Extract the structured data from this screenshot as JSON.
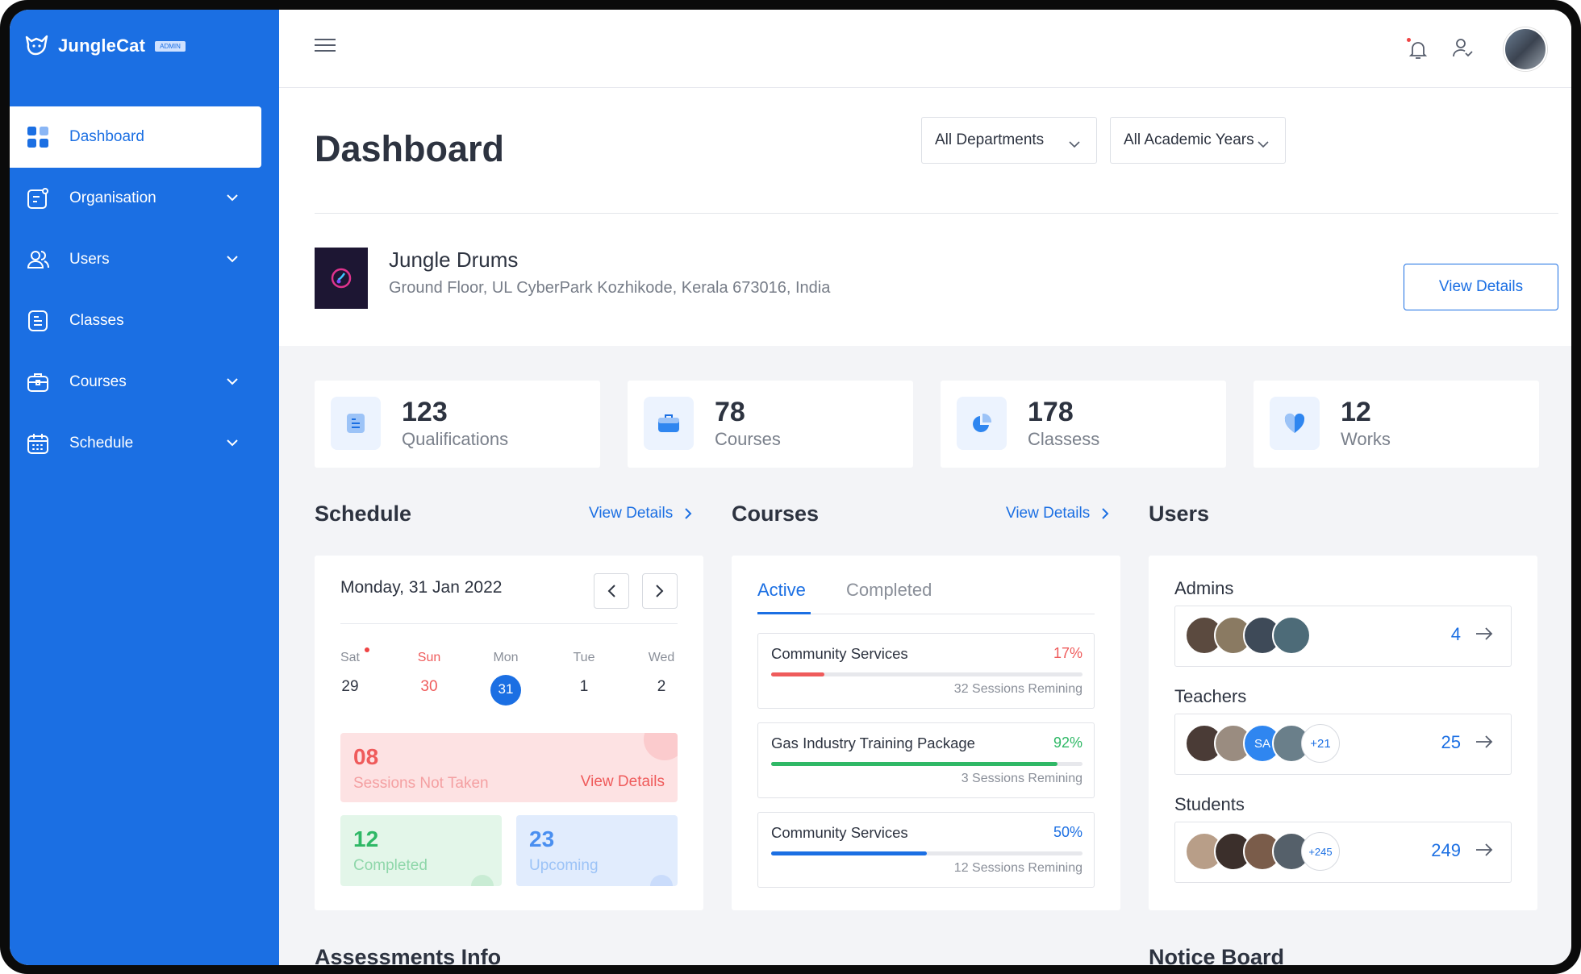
{
  "app": {
    "name": "JungleCat",
    "badge": "ADMIN"
  },
  "sidebar": {
    "items": [
      {
        "label": "Dashboard"
      },
      {
        "label": "Organisation"
      },
      {
        "label": "Users"
      },
      {
        "label": "Classes"
      },
      {
        "label": "Courses"
      },
      {
        "label": "Schedule"
      }
    ]
  },
  "header": {
    "title": "Dashboard",
    "department_select": "All Departments",
    "year_select": "All Academic Years"
  },
  "organisation": {
    "name": "Jungle Drums",
    "address": "Ground Floor, UL CyberPark Kozhikode, Kerala 673016, India",
    "view_details": "View Details"
  },
  "stats": [
    {
      "value": "123",
      "label": "Qualifications"
    },
    {
      "value": "78",
      "label": "Courses"
    },
    {
      "value": "178",
      "label": "Classess"
    },
    {
      "value": "12",
      "label": "Works"
    }
  ],
  "schedule": {
    "title": "Schedule",
    "view_details": "View Details",
    "date": "Monday, 31 Jan 2022",
    "days": [
      {
        "day": "Sat",
        "date": "29"
      },
      {
        "day": "Sun",
        "date": "30"
      },
      {
        "day": "Mon",
        "date": "31"
      },
      {
        "day": "Tue",
        "date": "1"
      },
      {
        "day": "Wed",
        "date": "2"
      }
    ],
    "not_taken": {
      "count": "08",
      "label": "Sessions Not Taken",
      "link": "View Details"
    },
    "completed": {
      "count": "12",
      "label": "Completed"
    },
    "upcoming": {
      "count": "23",
      "label": "Upcoming"
    }
  },
  "courses": {
    "title": "Courses",
    "view_details": "View Details",
    "tabs": [
      "Active",
      "Completed"
    ],
    "items": [
      {
        "name": "Community Services",
        "percent": "17%",
        "progress": 0.17,
        "sessions": "32 Sessions Remining",
        "color": "#ef5b5b"
      },
      {
        "name": "Gas Industry Training Package",
        "percent": "92%",
        "progress": 0.92,
        "sessions": "3 Sessions Remining",
        "color": "#2fb866"
      },
      {
        "name": "Community Services",
        "percent": "50%",
        "progress": 0.5,
        "sessions": "12 Sessions Remining",
        "color": "#1b6fe3"
      }
    ]
  },
  "users": {
    "title": "Users",
    "groups": [
      {
        "label": "Admins",
        "count": "4",
        "extra": ""
      },
      {
        "label": "Teachers",
        "count": "25",
        "extra": "+21",
        "initials": "SA"
      },
      {
        "label": "Students",
        "count": "249",
        "extra": "+245"
      }
    ]
  },
  "bottom": {
    "assessments": "Assessments Info",
    "notice": "Notice Board"
  },
  "colors": {
    "primary": "#1b6fe3",
    "danger": "#ef5b5b",
    "success": "#2fb866"
  }
}
